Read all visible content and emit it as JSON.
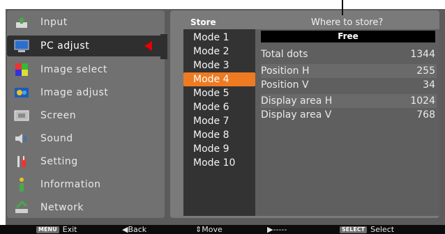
{
  "menu": {
    "items": [
      {
        "label": "Input",
        "icon": "input-icon"
      },
      {
        "label": "PC adjust",
        "icon": "pc-adjust-icon",
        "selected": true
      },
      {
        "label": "Image select",
        "icon": "image-select-icon"
      },
      {
        "label": "Image adjust",
        "icon": "image-adjust-icon"
      },
      {
        "label": "Screen",
        "icon": "screen-icon"
      },
      {
        "label": "Sound",
        "icon": "sound-icon"
      },
      {
        "label": "Setting",
        "icon": "setting-icon"
      },
      {
        "label": "Information",
        "icon": "information-icon"
      },
      {
        "label": "Network",
        "icon": "network-icon"
      }
    ]
  },
  "panel": {
    "store_label": "Store",
    "where_label": "Where to store?",
    "modes": [
      "Mode 1",
      "Mode 2",
      "Mode 3",
      "Mode 4",
      "Mode 5",
      "Mode 6",
      "Mode 7",
      "Mode 8",
      "Mode 9",
      "Mode 10"
    ],
    "selected_mode": "Mode 4",
    "free_label": "Free",
    "info": [
      {
        "label": "Total dots",
        "value": "1344"
      },
      {
        "label": "Position H",
        "value": "255"
      },
      {
        "label": "Position V",
        "value": "34"
      },
      {
        "label": "Display area H",
        "value": "1024"
      },
      {
        "label": "Display area V",
        "value": "768"
      }
    ]
  },
  "footer": {
    "exit_tag": "MENU",
    "exit_label": "Exit",
    "back_label": "◀Back",
    "move_label": "⇕Move",
    "next_label": "▶-----",
    "select_tag": "SELECT",
    "select_label": "Select"
  },
  "colors": {
    "selected_accent": "#ee7b22",
    "arrow": "#e60000"
  }
}
